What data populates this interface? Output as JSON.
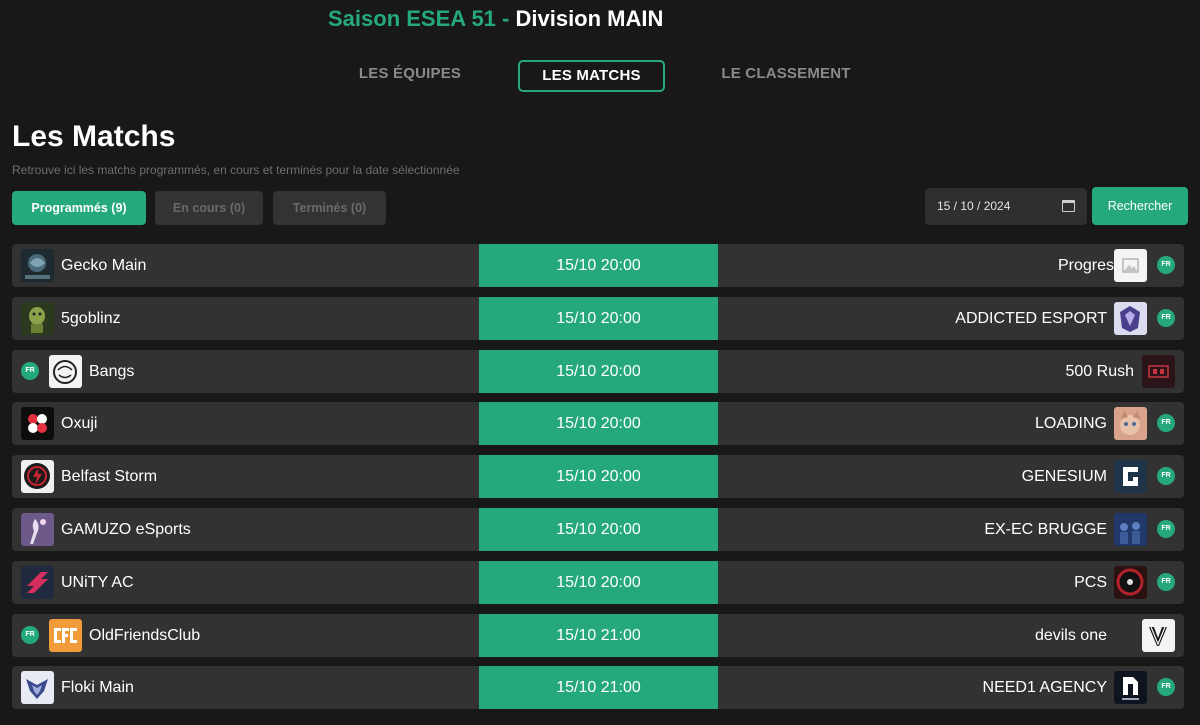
{
  "header": {
    "season_accent": "Saison ESEA 51 - ",
    "division": "Division MAIN"
  },
  "nav": {
    "teams": "LES ÉQUIPES",
    "matches": "LES MATCHS",
    "standings": "LE CLASSEMENT"
  },
  "section": {
    "title": "Les Matchs",
    "subtitle": "Retrouve ici les matchs programmés, en cours et terminés pour la date sélectionnée"
  },
  "filters": {
    "scheduled": "Programmés (9)",
    "ongoing": "En cours (0)",
    "finished": "Terminés (0)"
  },
  "search": {
    "date": "15 / 10 / 2024",
    "button": "Rechercher"
  },
  "badge_text": "FR",
  "colors": {
    "accent": "#25a97a",
    "background": "#181818",
    "row": "#323232"
  },
  "matches": [
    {
      "team1": "Gecko Main",
      "time": "15/10 20:00",
      "team2": "Progress"
    },
    {
      "team1": "5goblinz",
      "time": "15/10 20:00",
      "team2": "ADDICTED ESPORT"
    },
    {
      "team1": "Bangs",
      "time": "15/10 20:00",
      "team2": "500 Rush"
    },
    {
      "team1": "Oxuji",
      "time": "15/10 20:00",
      "team2": "LOADING"
    },
    {
      "team1": "Belfast Storm",
      "time": "15/10 20:00",
      "team2": "GENESIUM"
    },
    {
      "team1": "GAMUZO eSports",
      "time": "15/10 20:00",
      "team2": "EX-EC BRUGGE"
    },
    {
      "team1": "UNiTY AC",
      "time": "15/10 20:00",
      "team2": "PCS"
    },
    {
      "team1": "OldFriendsClub",
      "time": "15/10 21:00",
      "team2": "devils one"
    },
    {
      "team1": "Floki Main",
      "time": "15/10 21:00",
      "team2": "NEED1 AGENCY"
    }
  ]
}
